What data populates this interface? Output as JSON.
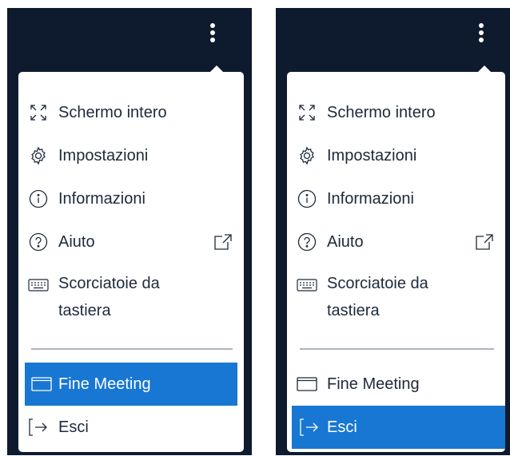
{
  "menus": [
    {
      "items": [
        {
          "label": "Schermo intero",
          "icon": "fullscreen-icon"
        },
        {
          "label": "Impostazioni",
          "icon": "gear-icon"
        },
        {
          "label": "Informazioni",
          "icon": "info-icon"
        },
        {
          "label": "Aiuto",
          "icon": "help-icon",
          "trailing_icon": "external-link-icon"
        },
        {
          "label": "Scorciatoie da tastiera",
          "icon": "keyboard-icon"
        },
        {
          "label": "Fine Meeting",
          "icon": "window-icon"
        },
        {
          "label": "Esci",
          "icon": "logout-icon"
        }
      ],
      "active_item": "Fine Meeting"
    },
    {
      "items": [
        {
          "label": "Schermo intero",
          "icon": "fullscreen-icon"
        },
        {
          "label": "Impostazioni",
          "icon": "gear-icon"
        },
        {
          "label": "Informazioni",
          "icon": "info-icon"
        },
        {
          "label": "Aiuto",
          "icon": "help-icon",
          "trailing_icon": "external-link-icon"
        },
        {
          "label": "Scorciatoie da tastiera",
          "icon": "keyboard-icon"
        },
        {
          "label": "Fine Meeting",
          "icon": "window-icon"
        },
        {
          "label": "Esci",
          "icon": "logout-icon"
        }
      ],
      "active_item": "Esci"
    }
  ],
  "colors": {
    "panel_background": "#0e1b2e",
    "menu_background": "#ffffff",
    "active_background": "#1877d2",
    "text": "#1d2a3a",
    "divider": "#aeb4bb"
  }
}
